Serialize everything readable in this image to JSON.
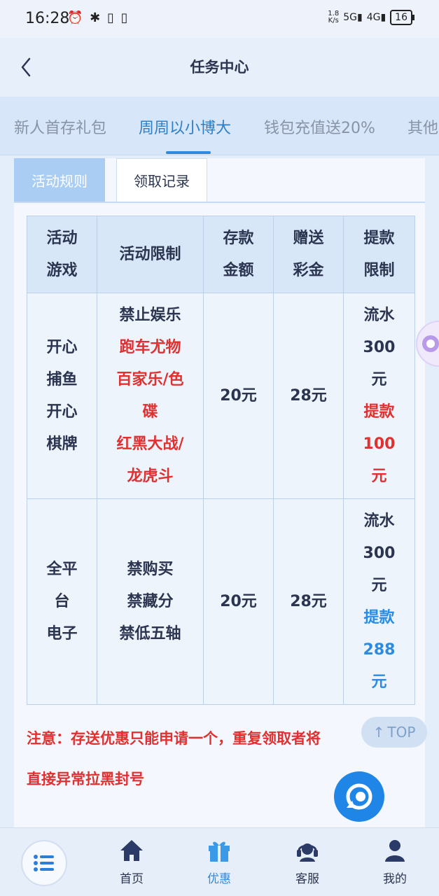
{
  "status_bar": {
    "time": "16:28",
    "left_icons": "⏰ ✱ ▯ ▯",
    "net_speed_value": "1.8",
    "net_speed_unit": "K/s",
    "signal_1": "5G",
    "signal_2": "4G",
    "battery": "16"
  },
  "header": {
    "title": "任务中心"
  },
  "tabs": [
    {
      "label": "新人首存礼包"
    },
    {
      "label": "周周以小博大"
    },
    {
      "label": "钱包充值送20%"
    },
    {
      "label": "其他"
    }
  ],
  "subtabs": {
    "rules": "活动规则",
    "records": "领取记录"
  },
  "table": {
    "headers": [
      [
        "活动",
        "游戏"
      ],
      [
        "活动限制"
      ],
      [
        "存款",
        "金额"
      ],
      [
        "赠送",
        "彩金"
      ],
      [
        "提款",
        "限制"
      ]
    ],
    "rows": [
      {
        "game": [
          "开心",
          "捕鱼",
          "开心",
          "棋牌"
        ],
        "limit_black": "禁止娱乐",
        "limit_red": [
          "跑车尤物",
          "百家乐/色",
          "碟",
          "红黑大战/",
          "龙虎斗"
        ],
        "deposit": "20元",
        "bonus": "28元",
        "withdraw_normal": [
          "流水",
          "300",
          "元"
        ],
        "withdraw_highlight": [
          "提款",
          "100",
          "元"
        ]
      },
      {
        "game": [
          "全平",
          "台",
          "电子"
        ],
        "limit_black": [
          "禁购买",
          "禁藏分",
          "禁低五轴"
        ],
        "deposit": "20元",
        "bonus": "28元",
        "withdraw_normal": [
          "流水",
          "300",
          "元"
        ],
        "withdraw_highlight": [
          "提款",
          "288",
          "元"
        ]
      }
    ]
  },
  "notice": {
    "line1": "注意：存送优惠只能申请一个，重复领取者将",
    "line2": "直接异常拉黑封号"
  },
  "top_button": {
    "label": "TOP"
  },
  "bottom_nav": [
    {
      "label": "首页",
      "icon": "home-icon"
    },
    {
      "label": "优惠",
      "icon": "gift-icon"
    },
    {
      "label": "客服",
      "icon": "headset-icon"
    },
    {
      "label": "我的",
      "icon": "user-icon"
    }
  ],
  "colors": {
    "accent": "#2c8be0",
    "highlight_red": "#e03030",
    "text": "#2b3550",
    "background": "#e4eefa"
  }
}
